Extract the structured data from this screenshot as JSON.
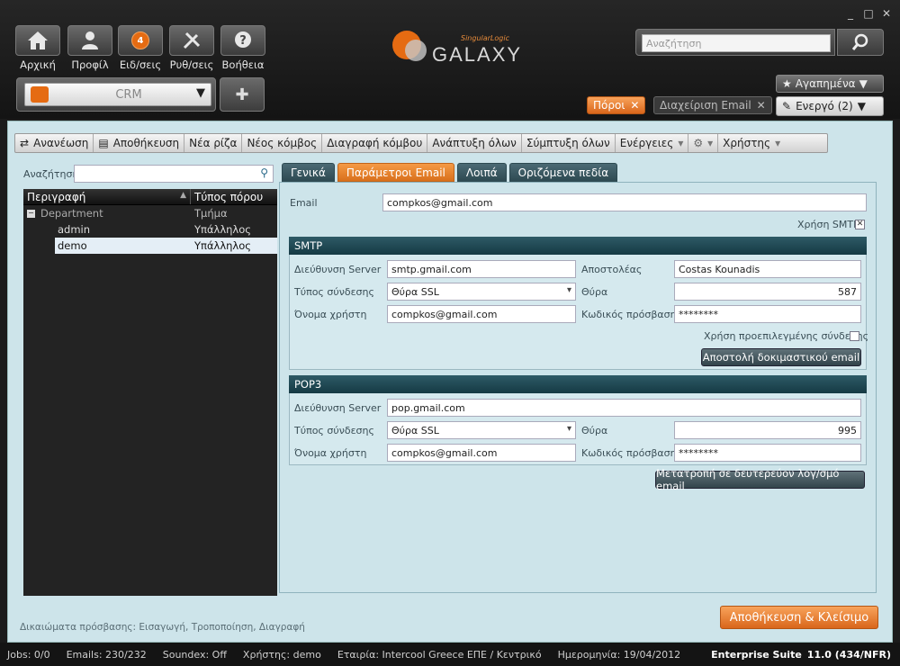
{
  "window": {
    "minimize": "_",
    "maximize": "□",
    "close": "✕"
  },
  "nav": [
    {
      "label": "Αρχική",
      "icon": "home-icon",
      "glyph": "⌂"
    },
    {
      "label": "Προφίλ",
      "icon": "profile-icon",
      "glyph": "☺"
    },
    {
      "label": "Ειδ/σεις",
      "icon": "notifications-icon",
      "badge": "4"
    },
    {
      "label": "Ρυθ/σεις",
      "icon": "settings-tools-icon",
      "glyph": "✕"
    },
    {
      "label": "Βοήθεια",
      "icon": "help-icon",
      "glyph": "?"
    }
  ],
  "module_select": {
    "value": "CRM"
  },
  "logo": {
    "text": "GALAXY",
    "subtext": "SingularLogic"
  },
  "search": {
    "placeholder": "Αναζήτηση"
  },
  "favorites": {
    "label": "Αγαπημένα"
  },
  "active": {
    "label": "Ενεργό (2)"
  },
  "open_tabs": [
    {
      "label": "Πόροι"
    },
    {
      "label": "Διαχείριση Email"
    }
  ],
  "toolbar": {
    "refresh": "Ανανέωση",
    "save": "Αποθήκευση",
    "new_root": "Νέα ρίζα",
    "new_node": "Νέος κόμβος",
    "delete_node": "Διαγραφή κόμβου",
    "expand_all": "Ανάπτυξη όλων",
    "collapse_all": "Σύμπτυξη όλων",
    "actions": "Ενέργειες",
    "user": "Χρήστης"
  },
  "left": {
    "search_label": "Αναζήτηση",
    "columns": [
      "Περιγραφή",
      "Τύπος πόρου"
    ],
    "rows": [
      {
        "name": "Department",
        "type": "Τμήμα"
      },
      {
        "name": "admin",
        "type": "Υπάλληλος"
      },
      {
        "name": "demo",
        "type": "Υπάλληλος"
      }
    ],
    "permissions": "Δικαιώματα πρόσβασης:  Εισαγωγή, Τροποποίηση, Διαγραφή"
  },
  "tabs": [
    "Γενικά",
    "Παράμετροι Email",
    "Λοιπά",
    "Οριζόμενα πεδία"
  ],
  "form": {
    "email_label": "Email",
    "email_value": "compkos@gmail.com",
    "use_smtp_label": "Χρήση SMTP",
    "smtp": {
      "title": "SMTP",
      "server_label": "Διεύθυνση Server",
      "server_value": "smtp.gmail.com",
      "sender_label": "Αποστολέας",
      "sender_value": "Costas Kounadis",
      "conn_label": "Τύπος σύνδεσης",
      "conn_value": "Θύρα SSL",
      "port_label": "Θύρα",
      "port_value": "587",
      "user_label": "Όνομα χρήστη",
      "user_value": "compkos@gmail.com",
      "pass_label": "Κωδικός πρόσβασης",
      "pass_value": "********",
      "default_conn_label": "Χρήση προεπιλεγμένης σύνδεσης",
      "test_button": "Αποστολή δοκιμαστικού email"
    },
    "pop3": {
      "title": "POP3",
      "server_label": "Διεύθυνση Server",
      "server_value": "pop.gmail.com",
      "conn_label": "Τύπος σύνδεσης",
      "conn_value": "Θύρα SSL",
      "port_label": "Θύρα",
      "port_value": "995",
      "user_label": "Όνομα χρήστη",
      "user_value": "compkos@gmail.com",
      "pass_label": "Κωδικός πρόσβασης",
      "pass_value": "********"
    },
    "convert_button": "Μετατροπή σε δευτερεύον λογ/σμό email"
  },
  "save_close": "Αποθήκευση & Κλείσιμο",
  "status": {
    "jobs": "Jobs: 0/0",
    "emails": "Emails: 230/232",
    "soundex": "Soundex: Off",
    "user": "Χρήστης: demo",
    "company": "Εταιρία: Intercool Greece ΕΠΕ / Κεντρικό",
    "date": "Ημερομηνία: 19/04/2012",
    "suite": "Enterprise Suite",
    "version": "11.0 (434/NFR)"
  },
  "colors": {
    "accent": "#e56b12",
    "header": "#1e4a55",
    "panel": "#cde4ea"
  }
}
